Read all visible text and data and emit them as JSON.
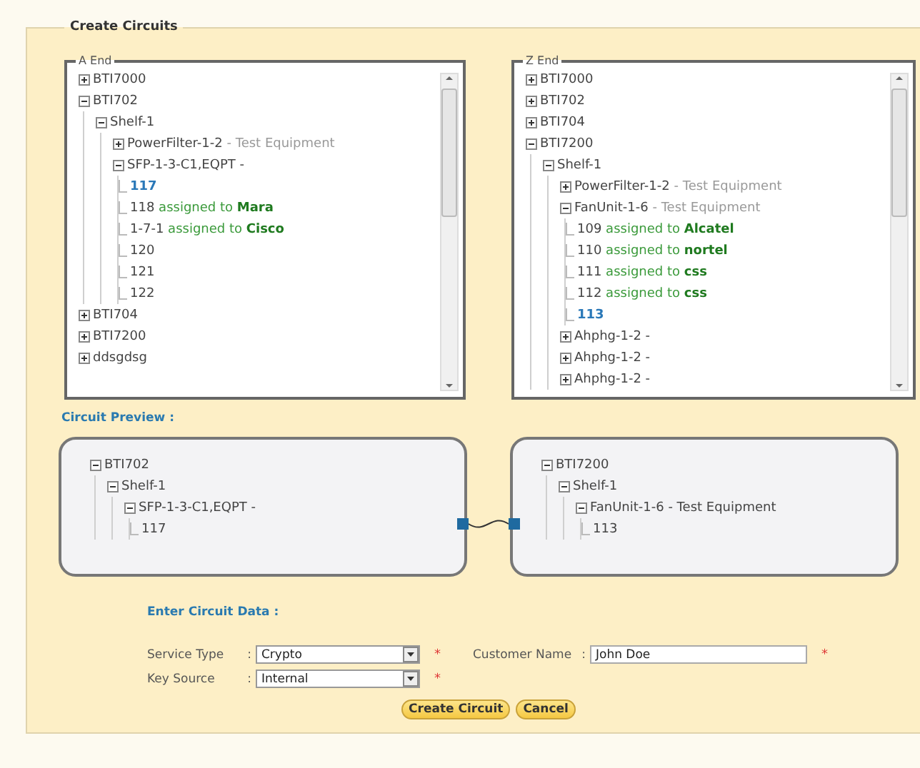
{
  "panel": {
    "title": "Create Circuits"
  },
  "a_end": {
    "title": "A End",
    "tree": [
      {
        "kind": "node",
        "label": "BTI7000",
        "expanded": false
      },
      {
        "kind": "node",
        "label": "BTI702",
        "expanded": true,
        "children": [
          {
            "kind": "node",
            "label": "Shelf-1",
            "expanded": true,
            "children": [
              {
                "kind": "node",
                "label": "PowerFilter-1-2",
                "detail": "- Test Equipment",
                "expanded": false
              },
              {
                "kind": "node",
                "label": "SFP-1-3-C1,EQPT -",
                "expanded": true,
                "children": [
                  {
                    "kind": "leaf",
                    "label": "117",
                    "selected": true
                  },
                  {
                    "kind": "leaf",
                    "label": "118",
                    "assignment": "assigned to **Mara**",
                    "selected": false
                  },
                  {
                    "kind": "leaf",
                    "label": "1-7-1",
                    "assignment": "assigned to **Cisco**",
                    "selected": false
                  },
                  {
                    "kind": "leaf",
                    "label": "120",
                    "selected": false
                  },
                  {
                    "kind": "leaf",
                    "label": "121",
                    "selected": false
                  },
                  {
                    "kind": "leaf",
                    "label": "122",
                    "selected": false
                  }
                ]
              }
            ]
          }
        ]
      },
      {
        "kind": "node",
        "label": "BTI704",
        "expanded": false
      },
      {
        "kind": "node",
        "label": "BTI7200",
        "expanded": false
      },
      {
        "kind": "node",
        "label": "ddsgdsg",
        "expanded": false
      }
    ]
  },
  "z_end": {
    "title": "Z End",
    "tree": [
      {
        "kind": "node",
        "label": "BTI7000",
        "expanded": false
      },
      {
        "kind": "node",
        "label": "BTI702",
        "expanded": false
      },
      {
        "kind": "node",
        "label": "BTI704",
        "expanded": false
      },
      {
        "kind": "node",
        "label": "BTI7200",
        "expanded": true,
        "children": [
          {
            "kind": "node",
            "label": "Shelf-1",
            "expanded": true,
            "children": [
              {
                "kind": "node",
                "label": "PowerFilter-1-2",
                "detail": "- Test Equipment",
                "expanded": false
              },
              {
                "kind": "node",
                "label": "FanUnit-1-6",
                "detail": "- Test Equipment",
                "expanded": true,
                "children": [
                  {
                    "kind": "leaf",
                    "label": "109",
                    "assignment": "assigned to **Alcatel**",
                    "selected": false
                  },
                  {
                    "kind": "leaf",
                    "label": "110",
                    "assignment": "assigned to **nortel**",
                    "selected": false
                  },
                  {
                    "kind": "leaf",
                    "label": "111",
                    "assignment": "assigned to **css**",
                    "selected": false
                  },
                  {
                    "kind": "leaf",
                    "label": "112",
                    "assignment": "assigned to **css**",
                    "selected": false
                  },
                  {
                    "kind": "leaf",
                    "label": "113",
                    "selected": true
                  }
                ]
              },
              {
                "kind": "node",
                "label": "Ahphg-1-2 -",
                "expanded": false
              },
              {
                "kind": "node",
                "label": "Ahphg-1-2 -",
                "expanded": false
              },
              {
                "kind": "node",
                "label": "Ahphg-1-2 -",
                "expanded": false
              }
            ]
          }
        ]
      }
    ]
  },
  "preview": {
    "title": "Circuit Preview :",
    "a_tree": [
      {
        "kind": "node",
        "label": "BTI702",
        "expanded": true,
        "children": [
          {
            "kind": "node",
            "label": "Shelf-1",
            "expanded": true,
            "children": [
              {
                "kind": "node",
                "label": "SFP-1-3-C1,EQPT -",
                "expanded": true,
                "children": [
                  {
                    "kind": "leaf",
                    "label": "117"
                  }
                ]
              }
            ]
          }
        ]
      }
    ],
    "z_tree": [
      {
        "kind": "node",
        "label": "BTI7200",
        "expanded": true,
        "children": [
          {
            "kind": "node",
            "label": "Shelf-1",
            "expanded": true,
            "children": [
              {
                "kind": "node",
                "label": "FanUnit-1-6 - Test Equipment",
                "expanded": true,
                "children": [
                  {
                    "kind": "leaf",
                    "label": "113"
                  }
                ]
              }
            ]
          }
        ]
      }
    ]
  },
  "form": {
    "title": "Enter Circuit Data :",
    "fields": [
      {
        "kind": "select",
        "label": "Service Type",
        "separator": ":",
        "value": "Crypto",
        "required_mark": "*"
      },
      {
        "kind": "text",
        "label": "Customer Name",
        "separator": ":",
        "value": "John Doe",
        "required_mark": "*"
      },
      {
        "kind": "select",
        "label": "Key Source",
        "separator": ":",
        "value": "Internal",
        "required_mark": "*"
      }
    ]
  },
  "buttons": [
    "Create Circuit",
    "Cancel"
  ]
}
